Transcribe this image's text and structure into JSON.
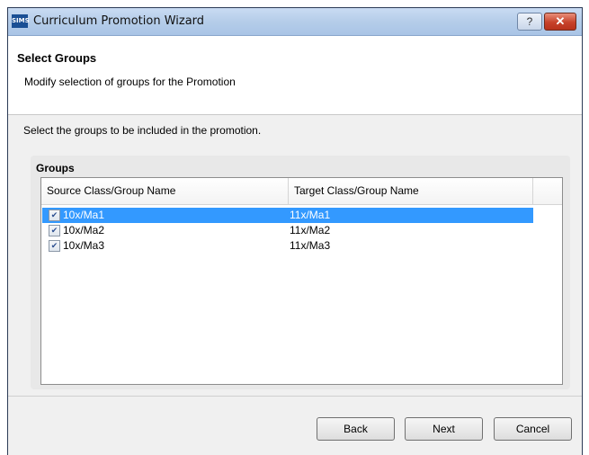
{
  "window": {
    "title": "Curriculum Promotion Wizard",
    "app_icon_text": "SIMS",
    "help_glyph": "?",
    "close_glyph": "✕"
  },
  "header": {
    "title": "Select Groups",
    "subtitle": "Modify selection of groups for the Promotion"
  },
  "instruction": "Select the groups to be included in the promotion.",
  "groups": {
    "label": "Groups",
    "columns": [
      "Source Class/Group Name",
      "Target Class/Group Name"
    ],
    "rows": [
      {
        "checked": true,
        "source": "10x/Ma1",
        "target": "11x/Ma1",
        "selected": true
      },
      {
        "checked": true,
        "source": "10x/Ma2",
        "target": "11x/Ma2",
        "selected": false
      },
      {
        "checked": true,
        "source": "10x/Ma3",
        "target": "11x/Ma3",
        "selected": false
      }
    ]
  },
  "buttons": {
    "back": "Back",
    "next": "Next",
    "cancel": "Cancel"
  },
  "colors": {
    "selection": "#3399ff",
    "close_button": "#c7412a"
  }
}
